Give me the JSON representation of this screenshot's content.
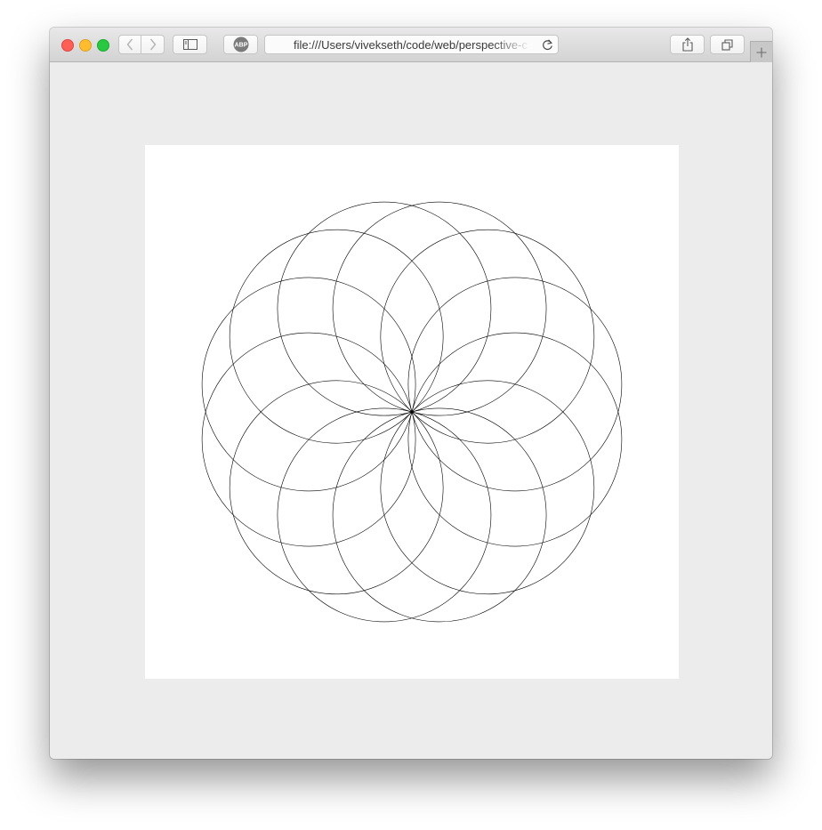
{
  "browser": {
    "url": "file:///Users/vivekseth/code/web/perspective-c",
    "icons": {
      "back": "chevron-left-icon",
      "forward": "chevron-right-icon",
      "sidebar": "sidebar-icon",
      "adblock": "adblock-plus-icon",
      "reload": "reload-icon",
      "share": "share-icon",
      "tabs": "tab-overview-icon",
      "new_tab": "plus-icon"
    },
    "adblock_badge": "ABP"
  },
  "artwork": {
    "colors": {
      "background": "#ffffff",
      "stroke": "#000000"
    }
  }
}
